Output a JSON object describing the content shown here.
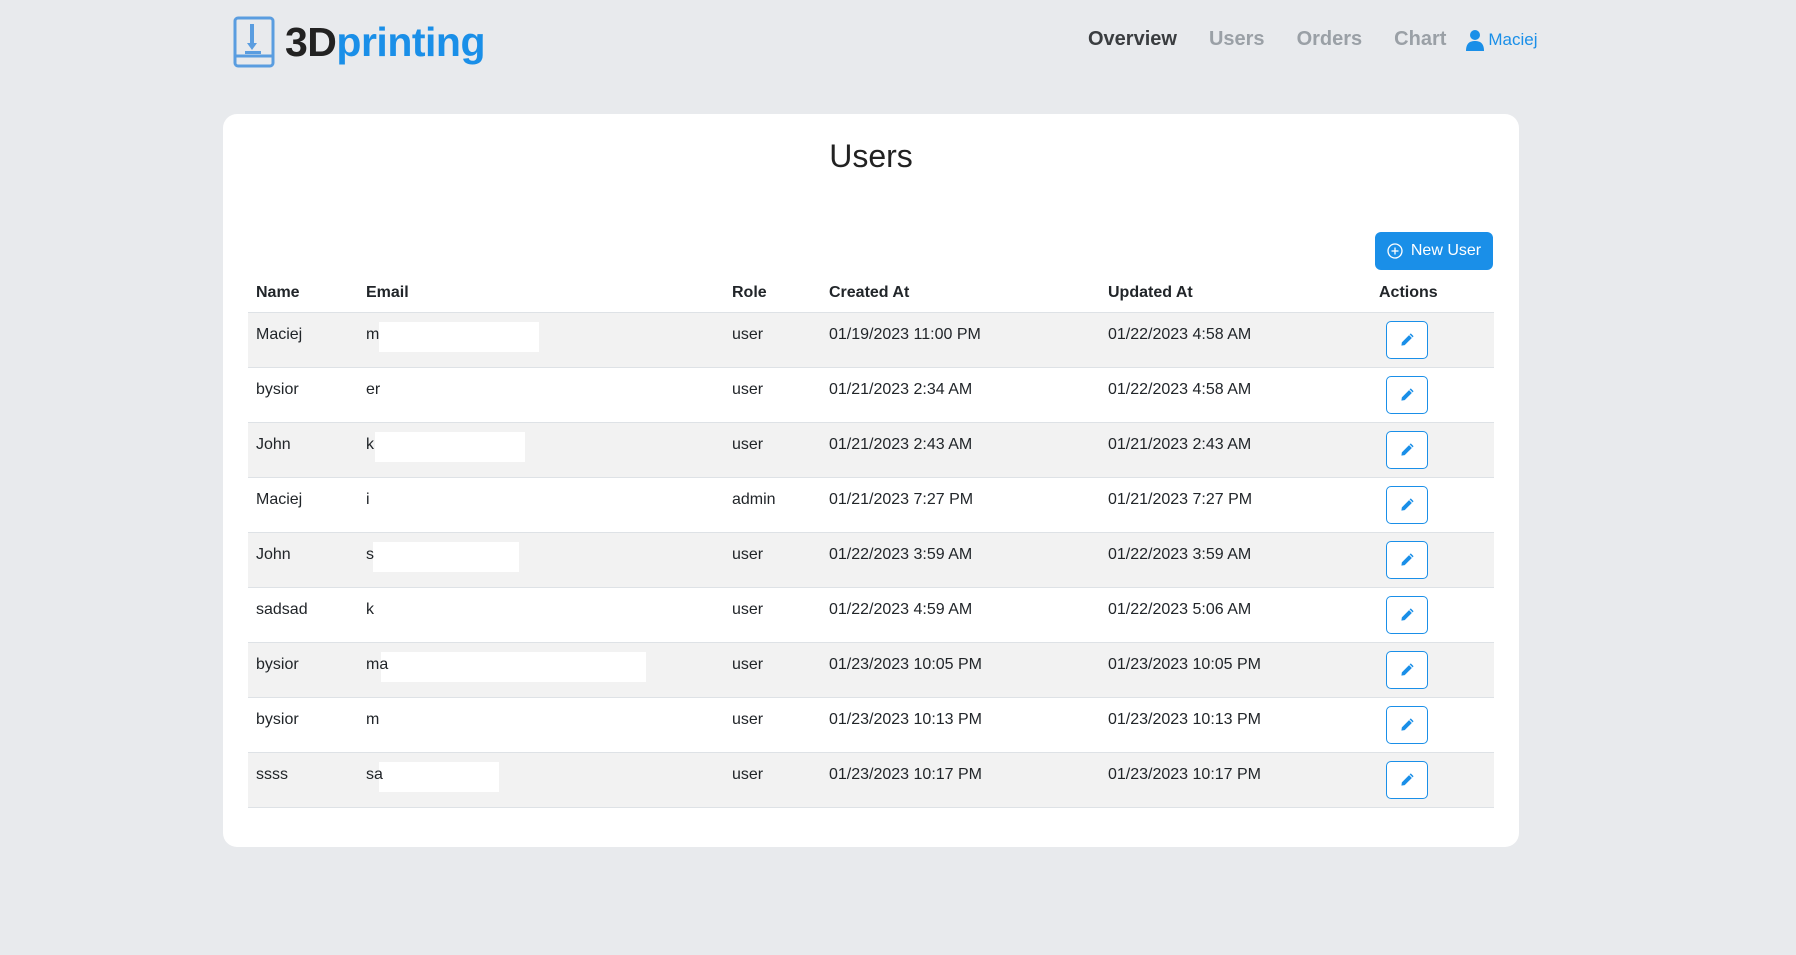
{
  "brand": {
    "part1": "3D",
    "part2": "printing"
  },
  "nav": {
    "links": [
      "Overview",
      "Users",
      "Orders",
      "Chart"
    ],
    "active": "Overview",
    "user": "Maciej"
  },
  "page": {
    "title": "Users",
    "new_user_label": "New User"
  },
  "table": {
    "headers": [
      "Name",
      "Email",
      "Role",
      "Created At",
      "Updated At",
      "Actions"
    ],
    "rows": [
      {
        "name": "Maciej",
        "email": "m",
        "role": "user",
        "created": "01/19/2023 11:00 PM",
        "updated": "01/22/2023 4:58 AM"
      },
      {
        "name": "bysior",
        "email": "er",
        "role": "user",
        "created": "01/21/2023 2:34 AM",
        "updated": "01/22/2023 4:58 AM"
      },
      {
        "name": "John",
        "email": "k",
        "role": "user",
        "created": "01/21/2023 2:43 AM",
        "updated": "01/21/2023 2:43 AM"
      },
      {
        "name": "Maciej",
        "email": "i",
        "role": "admin",
        "created": "01/21/2023 7:27 PM",
        "updated": "01/21/2023 7:27 PM"
      },
      {
        "name": "John",
        "email": "s",
        "role": "user",
        "created": "01/22/2023 3:59 AM",
        "updated": "01/22/2023 3:59 AM"
      },
      {
        "name": "sadsad",
        "email": "k",
        "role": "user",
        "created": "01/22/2023 4:59 AM",
        "updated": "01/22/2023 5:06 AM"
      },
      {
        "name": "bysior",
        "email": "ma",
        "role": "user",
        "created": "01/23/2023 10:05 PM",
        "updated": "01/23/2023 10:05 PM"
      },
      {
        "name": "bysior",
        "email": "m",
        "role": "user",
        "created": "01/23/2023 10:13 PM",
        "updated": "01/23/2023 10:13 PM"
      },
      {
        "name": "ssss",
        "email": "sa",
        "role": "user",
        "created": "01/23/2023 10:17 PM",
        "updated": "01/23/2023 10:17 PM"
      }
    ]
  },
  "colors": {
    "accent": "#1a8fe8",
    "background": "#e8eaed",
    "stripe": "#f2f2f2"
  }
}
